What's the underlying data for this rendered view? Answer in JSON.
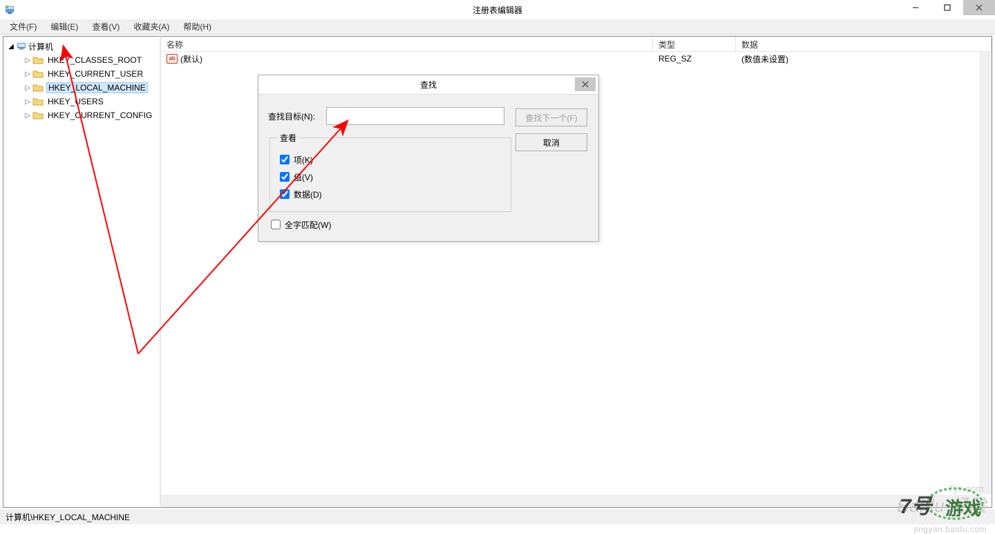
{
  "window": {
    "title": "注册表编辑器"
  },
  "menu": [
    "文件(F)",
    "编辑(E)",
    "查看(V)",
    "收藏夹(A)",
    "帮助(H)"
  ],
  "tree": {
    "root": "计算机",
    "items": [
      "HKEY_CLASSES_ROOT",
      "HKEY_CURRENT_USER",
      "HKEY_LOCAL_MACHINE",
      "HKEY_USERS",
      "HKEY_CURRENT_CONFIG"
    ],
    "selected_index": 2
  },
  "list": {
    "columns": {
      "name": "名称",
      "type": "类型",
      "data": "数据"
    },
    "rows": [
      {
        "name": "(默认)",
        "type": "REG_SZ",
        "data": "(数值未设置)"
      }
    ]
  },
  "statusbar": "计算机\\HKEY_LOCAL_MACHINE",
  "find_dialog": {
    "title": "查找",
    "target_label": "查找目标(N):",
    "target_value": "",
    "look_at_legend": "查看",
    "chk_keys": "项(K)",
    "chk_values": "值(V)",
    "chk_data": "数据(D)",
    "chk_whole": "全字匹配(W)",
    "btn_find_next": "查找下一个(F)",
    "btn_cancel": "取消",
    "keys_checked": true,
    "values_checked": true,
    "data_checked": true,
    "whole_checked": false
  },
  "watermarks": {
    "baidu": "Baidu 经验",
    "url": "jingyan.baidu.com",
    "game": "7号游戏"
  }
}
